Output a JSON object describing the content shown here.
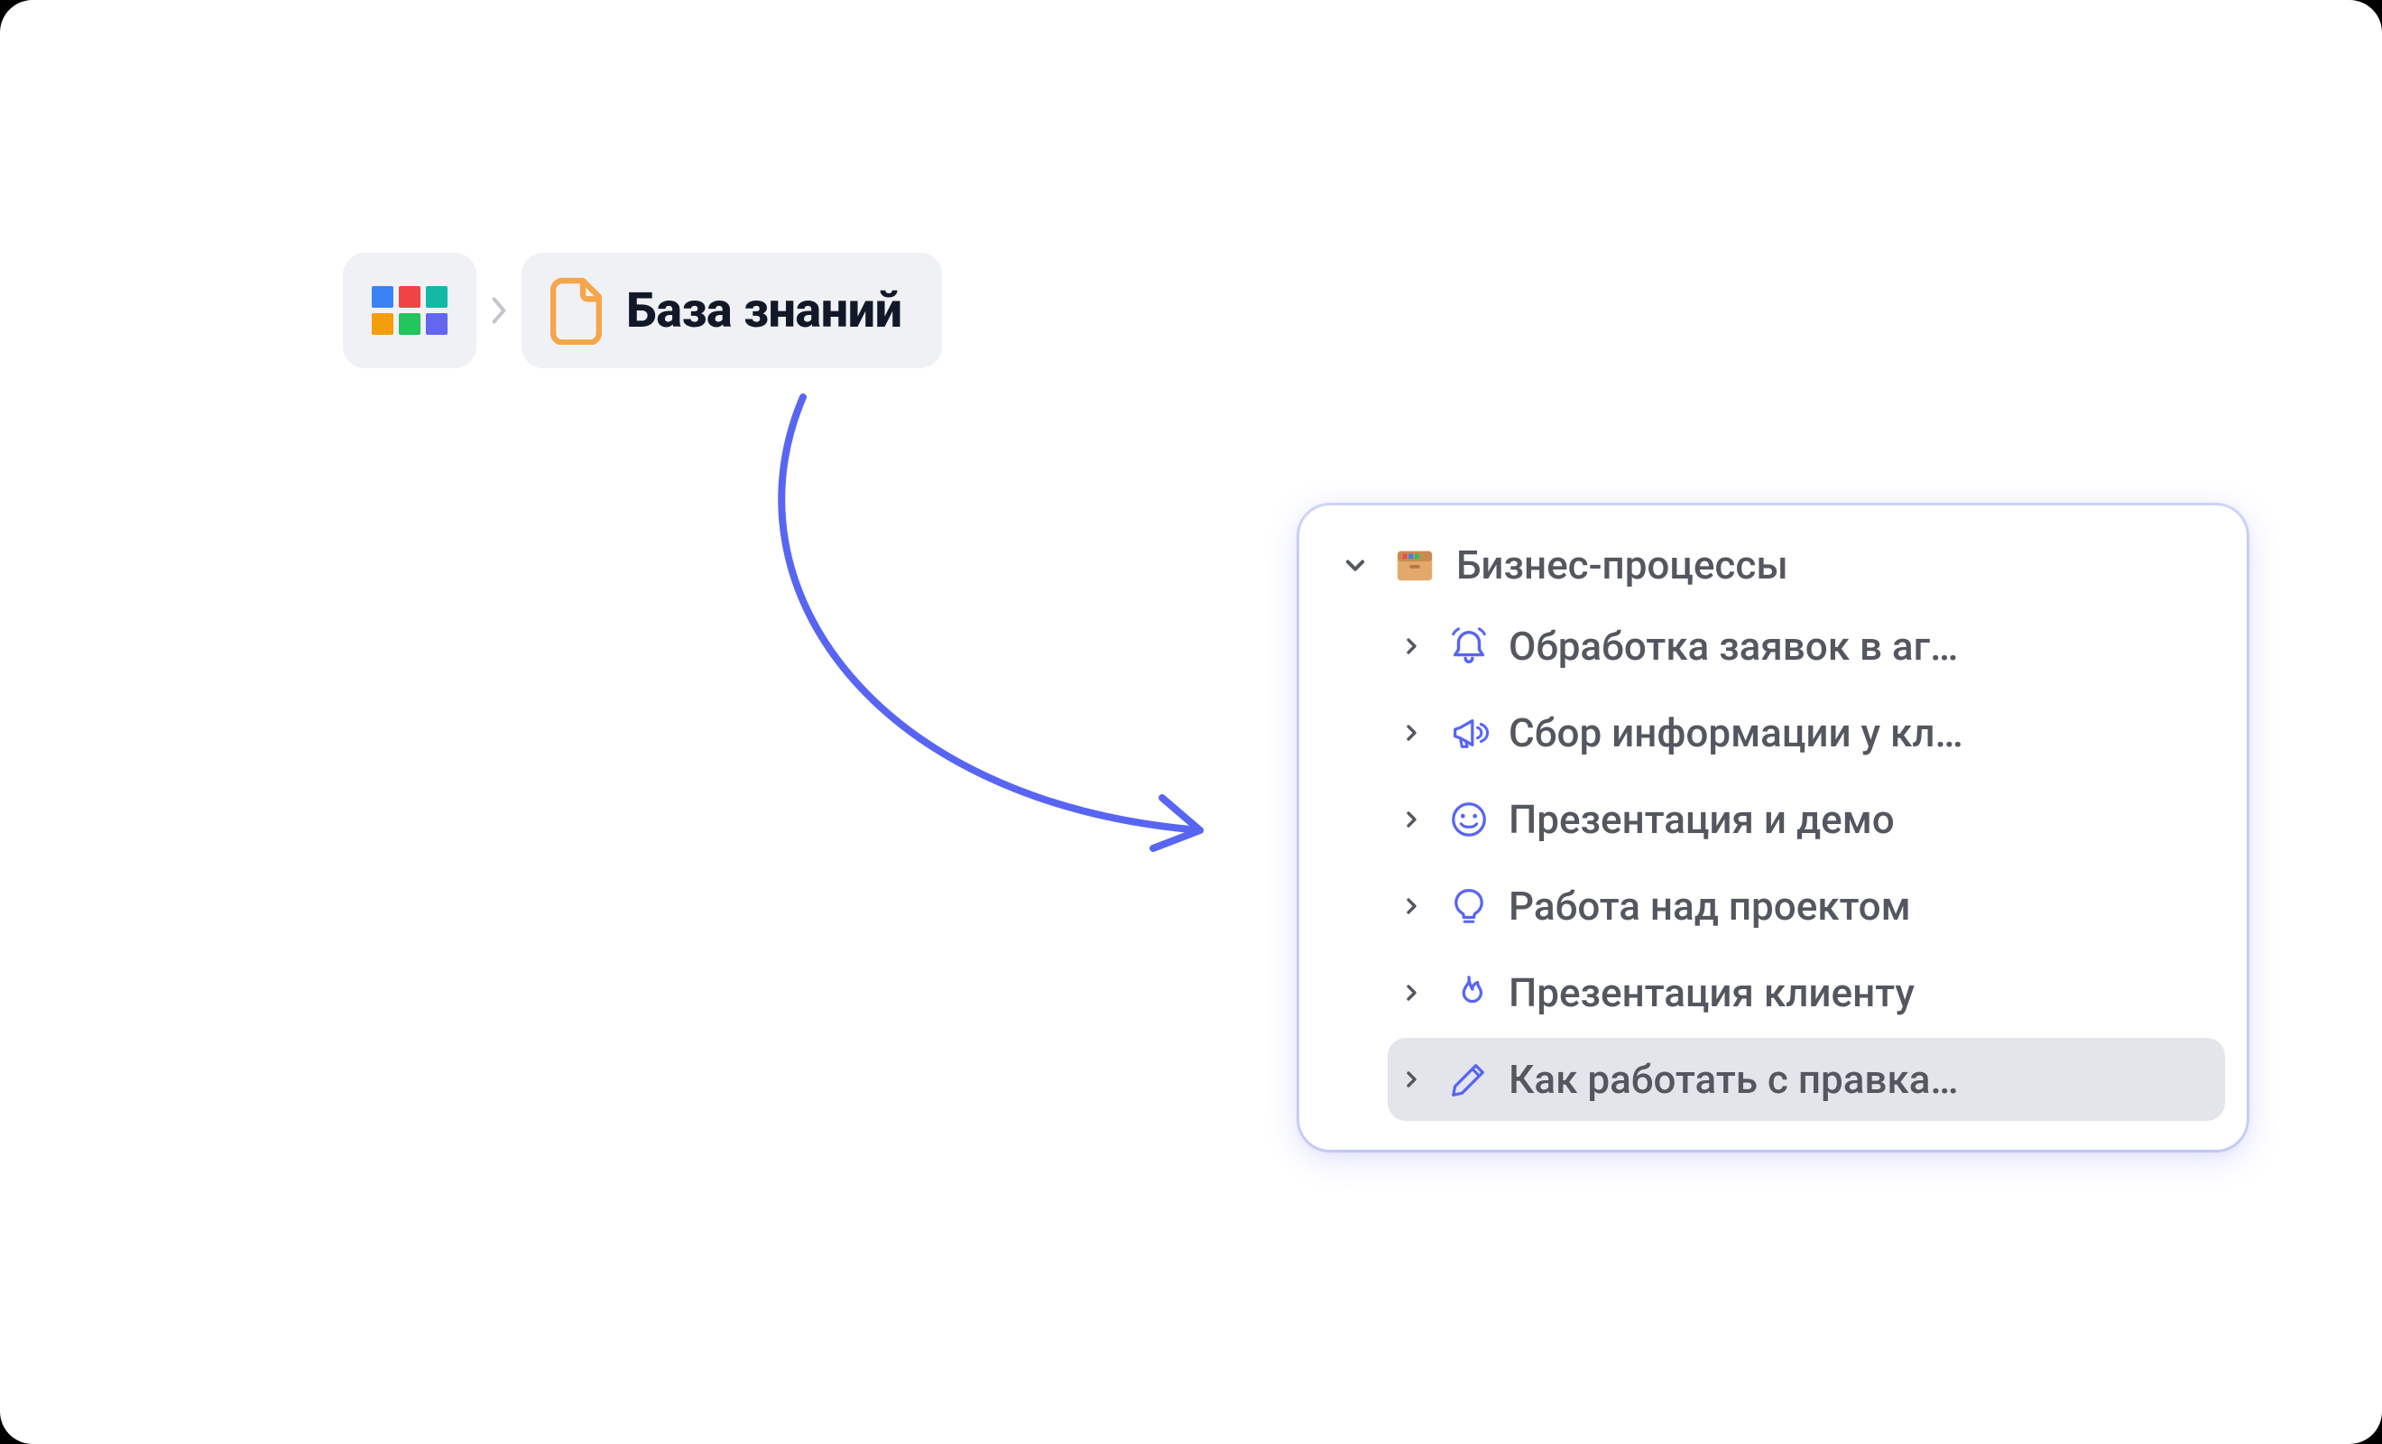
{
  "breadcrumb": {
    "title": "База знаний"
  },
  "tree": {
    "root": {
      "label": "Бизнес-процессы",
      "expanded": true
    },
    "children": [
      {
        "icon": "bell",
        "label": "Обработка заявок в аг…"
      },
      {
        "icon": "megaphone",
        "label": "Сбор информации у кл…"
      },
      {
        "icon": "smile",
        "label": "Презентация и демо"
      },
      {
        "icon": "bulb",
        "label": "Работа над проектом"
      },
      {
        "icon": "fire",
        "label": "Презентация клиенту"
      },
      {
        "icon": "pencil",
        "label": "Как работать с правка…"
      }
    ],
    "activeIndex": 5
  },
  "colors": {
    "accent": "#5865f2",
    "panelBg": "#ffffff",
    "chipBg": "#f0f1f4",
    "textStrong": "#111827",
    "textMuted": "#54575f",
    "rowActive": "#e3e5ea"
  }
}
